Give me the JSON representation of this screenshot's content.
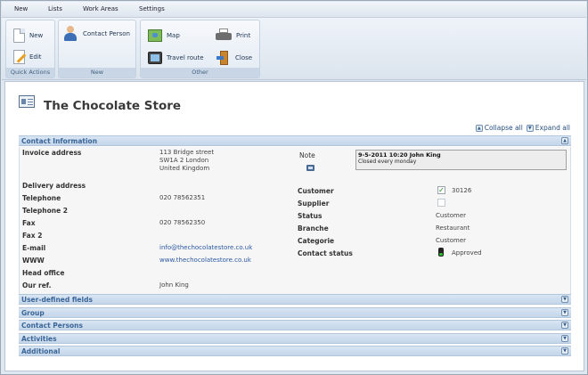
{
  "menu": [
    "New",
    "Lists",
    "Work Areas",
    "Settings"
  ],
  "ribbon": {
    "quick_actions": {
      "label": "Quick Actions",
      "new": "New",
      "edit": "Edit"
    },
    "new_group": {
      "label": "New",
      "contact_person": "Contact Person"
    },
    "other": {
      "label": "Other",
      "map": "Map",
      "travel_route": "Travel route",
      "print": "Print",
      "close": "Close"
    }
  },
  "page": {
    "title": "The Chocolate Store"
  },
  "links": {
    "collapse_all": "Collapse all",
    "expand_all": "Expand all"
  },
  "contact_info": {
    "title": "Contact Information",
    "invoice_address_label": "Invoice address",
    "invoice_address": [
      "113 Bridge street",
      "SW1A 2 London",
      "United Kingdom"
    ],
    "delivery_address_label": "Delivery address",
    "telephone_label": "Telephone",
    "telephone": "020 78562351",
    "telephone2_label": "Telephone 2",
    "fax_label": "Fax",
    "fax": "020 78562350",
    "fax2_label": "Fax 2",
    "email_label": "E-mail",
    "email": "info@thechocolatestore.co.uk",
    "www_label": "WWW",
    "www": "www.thechocolatestore.co.uk",
    "head_office_label": "Head office",
    "our_ref_label": "Our ref.",
    "our_ref": "John King",
    "note_label": "Note",
    "note_header": "9-5-2011 10:20 John King",
    "note_text": "Closed every monday",
    "customer_label": "Customer",
    "customer_checked": true,
    "customer_number": "30126",
    "supplier_label": "Supplier",
    "supplier_checked": false,
    "status_label": "Status",
    "status": "Customer",
    "branche_label": "Branche",
    "branche": "Restaurant",
    "categorie_label": "Categorie",
    "categorie": "Customer",
    "contact_status_label": "Contact status",
    "contact_status": "Approved"
  },
  "sections": [
    "User-defined fields",
    "Group",
    "Contact Persons",
    "Activities",
    "Additional"
  ],
  "colors": {
    "section_bar": "#c4d6ea",
    "section_title": "#3a6597",
    "link": "#2a58a0",
    "check": "#1a8a1a"
  }
}
